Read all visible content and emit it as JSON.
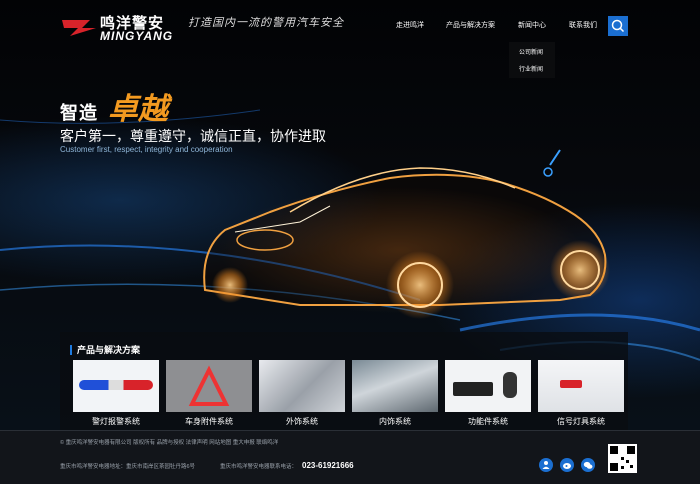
{
  "header": {
    "logo_cn": "鸣洋警安",
    "logo_en": "MINGYANG",
    "slogan": "打造国内一流的警用汽车安全",
    "nav": [
      "走进鸣洋",
      "产品与解决方案",
      "新闻中心",
      "联系我们"
    ],
    "dropdown": [
      "公司新闻",
      "行业新闻"
    ],
    "search_icon": "search-icon"
  },
  "hero": {
    "title": "智造",
    "accent": "卓越",
    "subtitle": "客户第一，尊重遵守，诚信正直，协作进取",
    "subtitle_en": "Customer first, respect, integrity and cooperation"
  },
  "products": {
    "heading": "产品与解决方案",
    "items": [
      {
        "label": "警灯报警系统",
        "icon": "lightbar-image"
      },
      {
        "label": "车身附件系统",
        "icon": "warning-triangle-image"
      },
      {
        "label": "外饰系统",
        "icon": "exterior-image"
      },
      {
        "label": "内饰系统",
        "icon": "interior-image"
      },
      {
        "label": "功能件系统",
        "icon": "siren-image"
      },
      {
        "label": "信号灯具系统",
        "icon": "signal-light-image"
      }
    ]
  },
  "footer": {
    "links": "© 重庆鸣洋警安电器有限公司 版权所有   品牌与授权   法律声明   网站地图   重大申报   联络鸣洋",
    "address": "重庆市鸣洋警安电器地址：重庆市南岸区茶园牡丹路6号",
    "contact_label": "重庆市鸣洋警安电器联系电话：",
    "phone": "023-61921666",
    "social_icons": [
      "person-icon",
      "weibo-icon",
      "wechat-icon"
    ]
  },
  "colors": {
    "accent": "#1b6fd1",
    "highlight": "#f39a20"
  }
}
